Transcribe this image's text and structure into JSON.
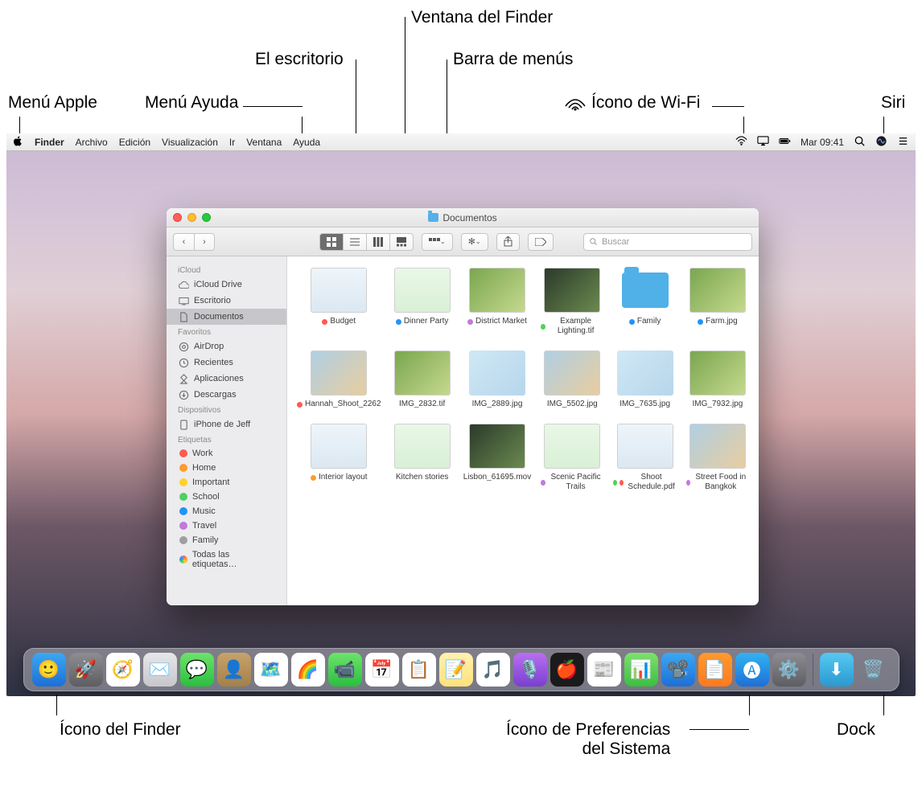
{
  "callouts": {
    "apple_menu": "Menú Apple",
    "help_menu": "Menú Ayuda",
    "desktop": "El escritorio",
    "finder_window": "Ventana del Finder",
    "menu_bar": "Barra de menús",
    "wifi_icon": "Ícono de Wi-Fi",
    "siri": "Siri",
    "finder_icon": "Ícono del Finder",
    "syspref_icon": "Ícono de Preferencias\ndel Sistema",
    "dock": "Dock"
  },
  "menubar": {
    "app": "Finder",
    "items": [
      "Archivo",
      "Edición",
      "Visualización",
      "Ir",
      "Ventana",
      "Ayuda"
    ],
    "clock": "Mar 09:41"
  },
  "finder": {
    "title": "Documentos",
    "search_placeholder": "Buscar",
    "sidebar": {
      "sections": [
        {
          "header": "iCloud",
          "items": [
            {
              "label": "iCloud Drive",
              "icon": "cloud"
            },
            {
              "label": "Escritorio",
              "icon": "desktop"
            },
            {
              "label": "Documentos",
              "icon": "doc",
              "selected": true
            }
          ]
        },
        {
          "header": "Favoritos",
          "items": [
            {
              "label": "AirDrop",
              "icon": "airdrop"
            },
            {
              "label": "Recientes",
              "icon": "clock"
            },
            {
              "label": "Aplicaciones",
              "icon": "apps"
            },
            {
              "label": "Descargas",
              "icon": "download"
            }
          ]
        },
        {
          "header": "Dispositivos",
          "items": [
            {
              "label": "iPhone de Jeff",
              "icon": "phone"
            }
          ]
        },
        {
          "header": "Etiquetas",
          "items": [
            {
              "label": "Work",
              "tag": "#ff5a52"
            },
            {
              "label": "Home",
              "tag": "#ff9a2e"
            },
            {
              "label": "Important",
              "tag": "#ffd12e"
            },
            {
              "label": "School",
              "tag": "#4fd15f"
            },
            {
              "label": "Music",
              "tag": "#2094fa"
            },
            {
              "label": "Travel",
              "tag": "#c179da"
            },
            {
              "label": "Family",
              "tag": "#9e9e9e"
            },
            {
              "label": "Todas las etiquetas…",
              "tag": "multi"
            }
          ]
        }
      ]
    },
    "files": [
      {
        "name": "Budget",
        "tag": "t-red",
        "thumb": "sheet"
      },
      {
        "name": "Dinner Party",
        "tag": "t-blue",
        "thumb": "doc"
      },
      {
        "name": "District Market",
        "tag": "t-purple",
        "thumb": "img1"
      },
      {
        "name": "Example Lighting.tif",
        "tag": "t-green",
        "thumb": "img2"
      },
      {
        "name": "Family",
        "tag": "t-blue",
        "thumb": "folder"
      },
      {
        "name": "Farm.jpg",
        "tag": "t-blue",
        "thumb": "img1"
      },
      {
        "name": "Hannah_Shoot_2262",
        "tag": "t-red",
        "thumb": "img3"
      },
      {
        "name": "IMG_2832.tif",
        "tag": "",
        "thumb": "img1"
      },
      {
        "name": "IMG_2889.jpg",
        "tag": "",
        "thumb": "img4"
      },
      {
        "name": "IMG_5502.jpg",
        "tag": "",
        "thumb": "img3"
      },
      {
        "name": "IMG_7635.jpg",
        "tag": "",
        "thumb": "img4"
      },
      {
        "name": "IMG_7932.jpg",
        "tag": "",
        "thumb": "img1"
      },
      {
        "name": "Interior layout",
        "tag": "t-orange",
        "thumb": "sheet"
      },
      {
        "name": "Kitchen stories",
        "tag": "",
        "thumb": "doc"
      },
      {
        "name": "Lisbon_61695.mov",
        "tag": "",
        "thumb": "img2"
      },
      {
        "name": "Scenic Pacific Trails",
        "tag": "t-purple",
        "thumb": "doc"
      },
      {
        "name": "Shoot Schedule.pdf",
        "tag": "t-green",
        "thumb2": "t-red",
        "thumb": "sheet"
      },
      {
        "name": "Street Food in Bangkok",
        "tag": "t-purple",
        "thumb": "img3"
      }
    ]
  },
  "dock": {
    "apps": [
      {
        "name": "finder",
        "bg": "linear-gradient(#3ba8f3,#1e6fd6)",
        "glyph": "🙂"
      },
      {
        "name": "launchpad",
        "bg": "linear-gradient(#8d8d92,#5d5d62)",
        "glyph": "🚀"
      },
      {
        "name": "safari",
        "bg": "#fff",
        "glyph": "🧭"
      },
      {
        "name": "mail",
        "bg": "linear-gradient(#e7e7ea,#c7c7cb)",
        "glyph": "✉️"
      },
      {
        "name": "messages",
        "bg": "linear-gradient(#6de36b,#2bbf3f)",
        "glyph": "💬"
      },
      {
        "name": "contacts",
        "bg": "linear-gradient(#c7a36b,#a3804a)",
        "glyph": "👤"
      },
      {
        "name": "maps",
        "bg": "#fff",
        "glyph": "🗺️"
      },
      {
        "name": "photos",
        "bg": "#fff",
        "glyph": "🌈"
      },
      {
        "name": "facetime",
        "bg": "linear-gradient(#6de36b,#2bbf3f)",
        "glyph": "📹"
      },
      {
        "name": "calendar",
        "bg": "#fff",
        "glyph": "📅"
      },
      {
        "name": "reminders",
        "bg": "#fff",
        "glyph": "📋"
      },
      {
        "name": "notes",
        "bg": "linear-gradient(#fff1b0,#ffe27a)",
        "glyph": "📝"
      },
      {
        "name": "music",
        "bg": "#fff",
        "glyph": "🎵"
      },
      {
        "name": "podcasts",
        "bg": "linear-gradient(#b96ff0,#7a3fd0)",
        "glyph": "🎙️"
      },
      {
        "name": "tv",
        "bg": "#1b1b1d",
        "glyph": "🍎"
      },
      {
        "name": "news",
        "bg": "#fff",
        "glyph": "📰"
      },
      {
        "name": "numbers",
        "bg": "linear-gradient(#7fe06e,#3bbf3f)",
        "glyph": "📊"
      },
      {
        "name": "keynote",
        "bg": "linear-gradient(#3ba8f3,#1e6fd6)",
        "glyph": "📽️"
      },
      {
        "name": "pages",
        "bg": "linear-gradient(#ff9a2e,#ff7a1e)",
        "glyph": "📄"
      },
      {
        "name": "appstore",
        "bg": "linear-gradient(#32b3f2,#1e6fd6)",
        "glyph": "🅐"
      },
      {
        "name": "system-preferences",
        "bg": "linear-gradient(#8d8d92,#5d5d62)",
        "glyph": "⚙️"
      }
    ],
    "right": [
      {
        "name": "downloads",
        "bg": "linear-gradient(#57c7f2,#2a9ad0)",
        "glyph": "⬇︎"
      },
      {
        "name": "trash",
        "bg": "transparent",
        "glyph": "🗑️"
      }
    ]
  }
}
